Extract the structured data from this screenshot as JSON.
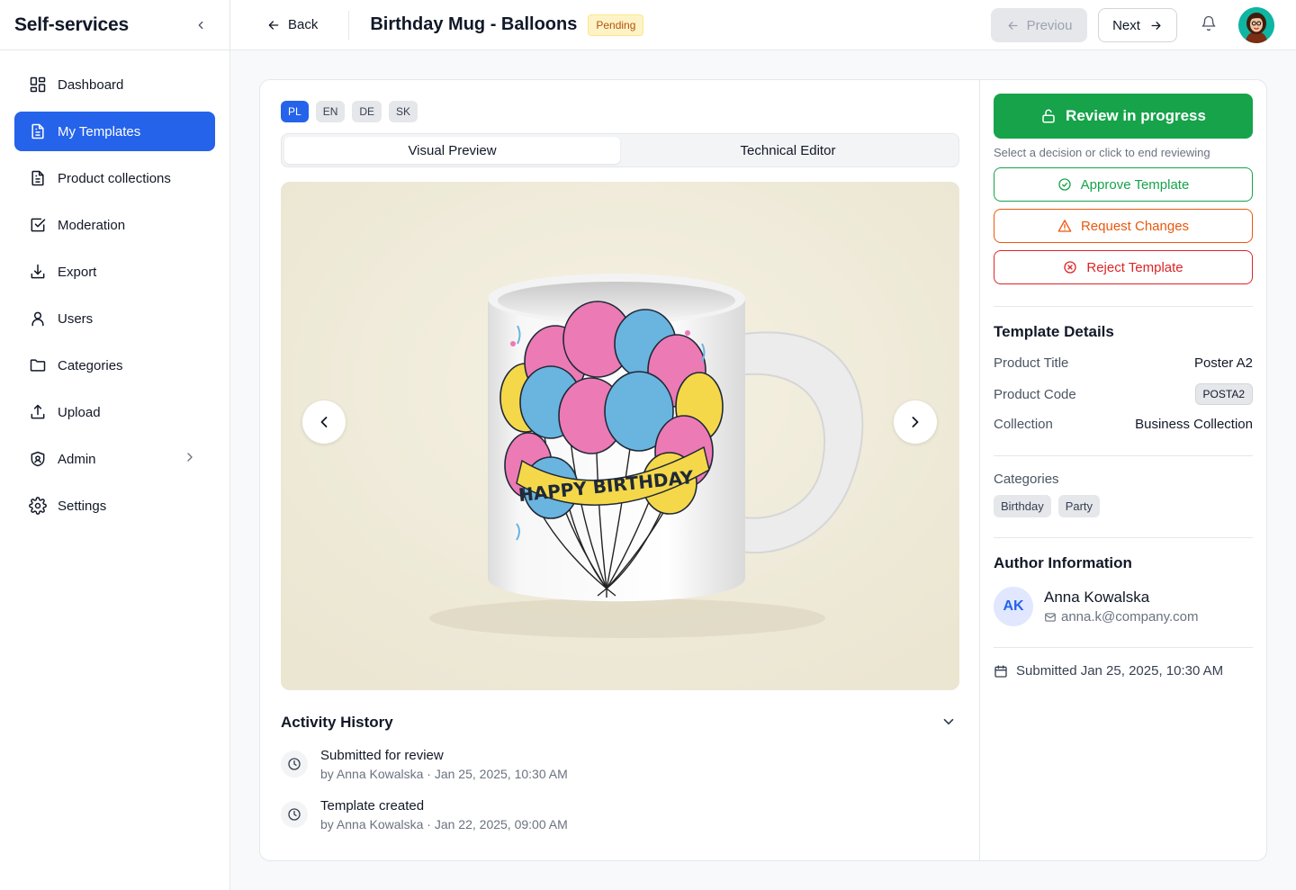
{
  "app": {
    "title": "Self-services"
  },
  "sidebar": {
    "items": [
      {
        "label": "Dashboard",
        "icon": "dashboard-icon",
        "active": false
      },
      {
        "label": "My Templates",
        "icon": "file-icon",
        "active": true
      },
      {
        "label": "Product collections",
        "icon": "document-icon",
        "active": false
      },
      {
        "label": "Moderation",
        "icon": "checkbox-icon",
        "active": false
      },
      {
        "label": "Export",
        "icon": "download-icon",
        "active": false
      },
      {
        "label": "Users",
        "icon": "user-icon",
        "active": false
      },
      {
        "label": "Categories",
        "icon": "folder-icon",
        "active": false
      },
      {
        "label": "Upload",
        "icon": "upload-icon",
        "active": false
      },
      {
        "label": "Admin",
        "icon": "shield-icon",
        "active": false
      },
      {
        "label": "Settings",
        "icon": "gear-icon",
        "active": false
      }
    ]
  },
  "header": {
    "back_label": "Back",
    "title": "Birthday Mug - Balloons",
    "status": "Pending",
    "prev_label": "Previou",
    "next_label": "Next"
  },
  "languages": [
    "PL",
    "EN",
    "DE",
    "SK"
  ],
  "active_language": "PL",
  "tabs": [
    {
      "label": "Visual Preview",
      "active": true
    },
    {
      "label": "Technical Editor",
      "active": false
    }
  ],
  "preview": {
    "image": "birthday-mug-balloons",
    "mug_text": "HAPPY BIRTHDAY"
  },
  "activity": {
    "title": "Activity History",
    "items": [
      {
        "title": "Submitted for review",
        "meta": "by Anna Kowalska · Jan 25, 2025, 10:30 AM"
      },
      {
        "title": "Template created",
        "meta": "by Anna Kowalska · Jan 22, 2025, 09:00 AM"
      }
    ]
  },
  "review": {
    "button_label": "Review in progress",
    "hint": "Select a decision or click to end reviewing",
    "approve_label": "Approve Template",
    "changes_label": "Request Changes",
    "reject_label": "Reject Template"
  },
  "details": {
    "title": "Template Details",
    "rows": [
      {
        "label": "Product Title",
        "value": "Poster A2"
      },
      {
        "label": "Product Code",
        "value": "POSTA2"
      },
      {
        "label": "Collection",
        "value": "Business Collection"
      }
    ],
    "categories_label": "Categories",
    "categories": [
      "Birthday",
      "Party"
    ]
  },
  "author": {
    "title": "Author Information",
    "initials": "AK",
    "name": "Anna Kowalska",
    "email": "anna.k@company.com"
  },
  "submitted": "Submitted Jan 25, 2025, 10:30 AM",
  "colors": {
    "primary": "#2563eb",
    "success": "#16a34a",
    "warning": "#ea580c",
    "danger": "#dc2626",
    "pending_bg": "#fef3c7"
  }
}
